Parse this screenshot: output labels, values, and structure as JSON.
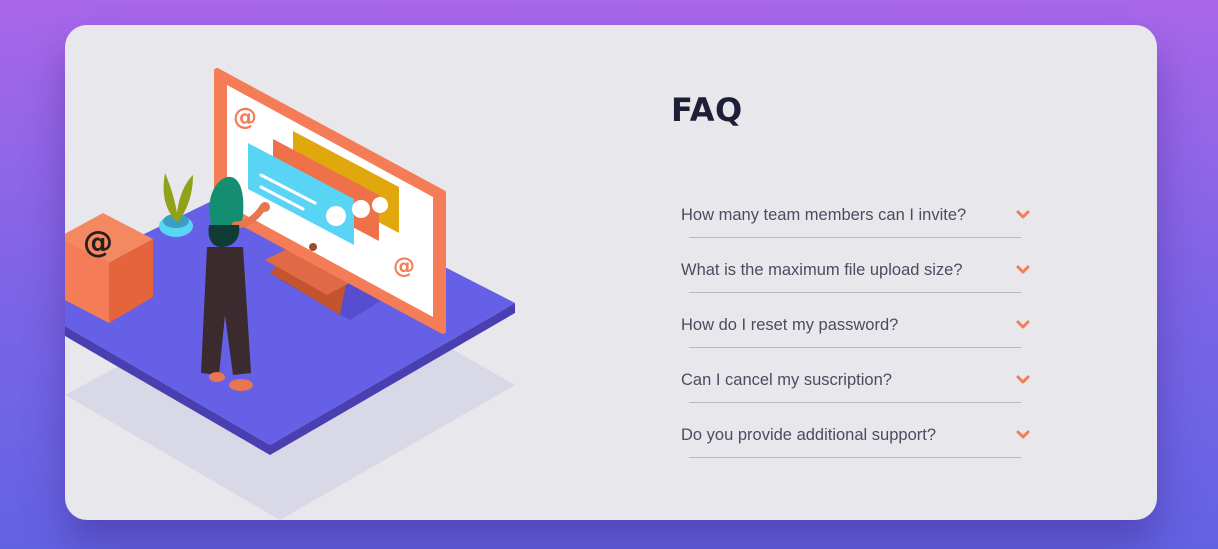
{
  "faq": {
    "title": "FAQ",
    "items": [
      {
        "question": "How many team members can I invite?"
      },
      {
        "question": "What is the maximum file upload size?"
      },
      {
        "question": "How do I reset my password?"
      },
      {
        "question": "Can I cancel my suscription?"
      },
      {
        "question": "Do you provide additional support?"
      }
    ]
  },
  "colors": {
    "background_top": "#a967ea",
    "background_bottom": "#6263e3",
    "card": "#e8e7eb",
    "heading": "#1e1f36",
    "question_text": "#4b4c5f",
    "accent": "#f47c57",
    "divider": "#b9b9c4"
  },
  "icons": {
    "chevron": "chevron-down-icon",
    "at_sign": "at-sign-icon"
  }
}
